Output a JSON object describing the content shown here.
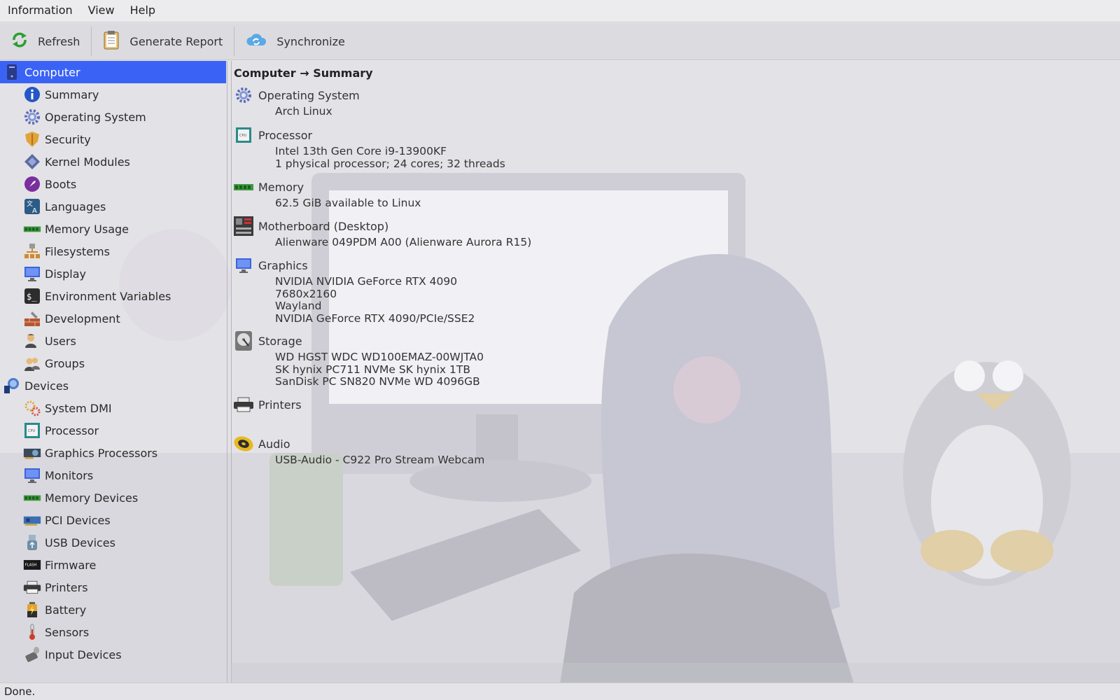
{
  "menubar": {
    "items": [
      "Information",
      "View",
      "Help"
    ]
  },
  "toolbar": {
    "refresh_label": "Refresh",
    "report_label": "Generate Report",
    "sync_label": "Synchronize"
  },
  "tree": {
    "items": [
      {
        "label": "Computer",
        "icon": "computer-icon",
        "level": 0,
        "selected": true
      },
      {
        "label": "Summary",
        "icon": "info-icon",
        "level": 1
      },
      {
        "label": "Operating System",
        "icon": "gear-icon",
        "level": 1
      },
      {
        "label": "Security",
        "icon": "shield-icon",
        "level": 1
      },
      {
        "label": "Kernel Modules",
        "icon": "module-icon",
        "level": 1
      },
      {
        "label": "Boots",
        "icon": "rocket-icon",
        "level": 1
      },
      {
        "label": "Languages",
        "icon": "language-icon",
        "level": 1
      },
      {
        "label": "Memory Usage",
        "icon": "memory-icon",
        "level": 1
      },
      {
        "label": "Filesystems",
        "icon": "filesystem-icon",
        "level": 1
      },
      {
        "label": "Display",
        "icon": "display-icon",
        "level": 1
      },
      {
        "label": "Environment Variables",
        "icon": "terminal-icon",
        "level": 1
      },
      {
        "label": "Development",
        "icon": "development-icon",
        "level": 1
      },
      {
        "label": "Users",
        "icon": "user-icon",
        "level": 1
      },
      {
        "label": "Groups",
        "icon": "group-icon",
        "level": 1
      },
      {
        "label": "Devices",
        "icon": "devices-icon",
        "level": 0
      },
      {
        "label": "System DMI",
        "icon": "dmi-icon",
        "level": 1
      },
      {
        "label": "Processor",
        "icon": "cpu-icon",
        "level": 1
      },
      {
        "label": "Graphics Processors",
        "icon": "gpu-icon",
        "level": 1
      },
      {
        "label": "Monitors",
        "icon": "monitor-icon",
        "level": 1
      },
      {
        "label": "Memory Devices",
        "icon": "memory-icon",
        "level": 1
      },
      {
        "label": "PCI Devices",
        "icon": "pci-icon",
        "level": 1
      },
      {
        "label": "USB Devices",
        "icon": "usb-icon",
        "level": 1
      },
      {
        "label": "Firmware",
        "icon": "flash-icon",
        "level": 1
      },
      {
        "label": "Printers",
        "icon": "printer-icon",
        "level": 1
      },
      {
        "label": "Battery",
        "icon": "battery-icon",
        "level": 1
      },
      {
        "label": "Sensors",
        "icon": "thermometer-icon",
        "level": 1
      },
      {
        "label": "Input Devices",
        "icon": "input-icon",
        "level": 1
      }
    ]
  },
  "content": {
    "breadcrumb": "Computer → Summary",
    "sections": [
      {
        "title": "Operating System",
        "icon": "gear-icon",
        "values": [
          "Arch Linux"
        ]
      },
      {
        "title": "Processor",
        "icon": "cpu-icon",
        "values": [
          "Intel 13th Gen Core i9-13900KF",
          "1 physical processor; 24 cores; 32 threads"
        ]
      },
      {
        "title": "Memory",
        "icon": "memory-icon",
        "values": [
          "62.5 GiB available to Linux"
        ]
      },
      {
        "title": "Motherboard (Desktop)",
        "icon": "motherboard-icon",
        "values": [
          "Alienware 049PDM A00 (Alienware Aurora R15)"
        ]
      },
      {
        "title": "Graphics",
        "icon": "display-icon",
        "values": [
          "NVIDIA NVIDIA GeForce RTX 4090",
          "7680x2160",
          "Wayland",
          "NVIDIA GeForce RTX 4090/PCIe/SSE2"
        ]
      },
      {
        "title": "Storage",
        "icon": "disk-icon",
        "values": [
          "WD  HGST WDC WD100EMAZ-00WJTA0",
          "SK hynix PC711 NVMe SK hynix 1TB",
          "SanDisk PC SN820 NVMe WD 4096GB"
        ]
      },
      {
        "title": "Printers",
        "icon": "printer-icon",
        "values": []
      },
      {
        "title": "Audio",
        "icon": "speaker-icon",
        "values": [
          "USB-Audio - C922 Pro Stream Webcam"
        ]
      }
    ]
  },
  "status": {
    "text": "Done."
  },
  "colors": {
    "selection": "#3a63f6"
  }
}
